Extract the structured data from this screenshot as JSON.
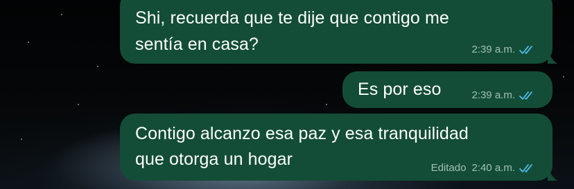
{
  "colors": {
    "outgoing_bubble": "#134d37",
    "text": "#ffffff",
    "meta_text": "#b9d3c6",
    "read_check": "#53bdeb"
  },
  "messages": [
    {
      "text_line_1": "Shi, recuerda que te dije que contigo me",
      "text_line_2": "sentía en casa?",
      "time": "2:39 a.m.",
      "status_icon": "double-check-read-icon"
    },
    {
      "text_line_1": "Es por eso",
      "time": "2:39 a.m.",
      "status_icon": "double-check-read-icon"
    },
    {
      "text_line_1": "Contigo alcanzo esa paz y esa tranquilidad",
      "text_line_2": "que otorga un hogar",
      "edited_label": "Editado",
      "time": "2:40 a.m.",
      "status_icon": "double-check-read-icon"
    }
  ]
}
